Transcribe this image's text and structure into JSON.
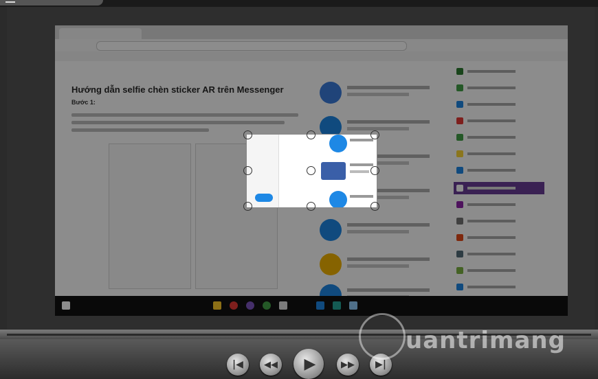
{
  "video": {
    "article_heading": "Hướng dẫn selfie chèn sticker AR trên Messenger",
    "article_step": "Bước 1:"
  },
  "controls": {
    "prev_icon": "skip-previous-icon",
    "rewind_icon": "rewind-icon",
    "play_icon": "play-icon",
    "forward_icon": "fast-forward-icon",
    "next_icon": "skip-next-icon"
  },
  "watermark": {
    "text": "uantrimang"
  },
  "colors": {
    "accent_purple": "#6b3d98",
    "messenger_blue": "#1e88e5"
  }
}
